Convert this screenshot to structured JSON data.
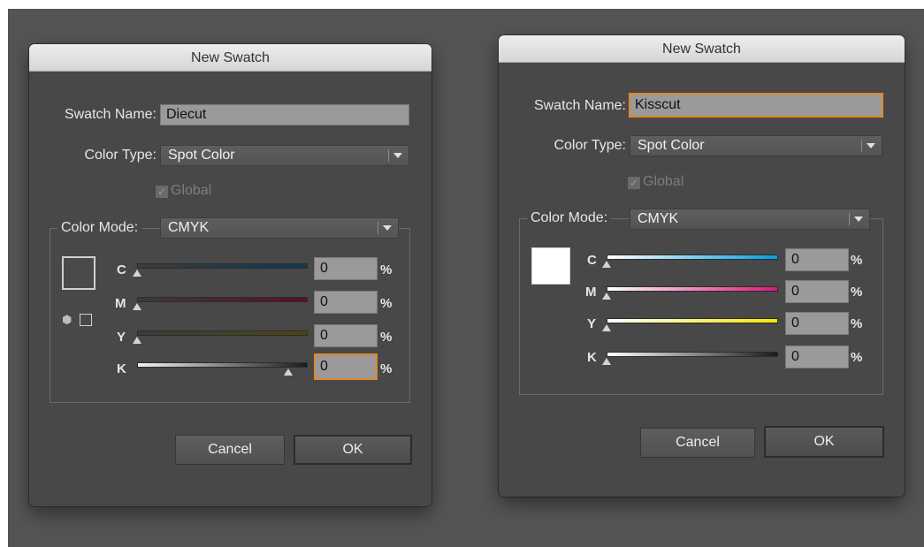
{
  "dialogs": [
    {
      "title": "New Swatch",
      "swatch_name_label": "Swatch Name:",
      "swatch_name_value": "Diecut",
      "color_type_label": "Color Type:",
      "color_type_value": "Spot Color",
      "global_label": "Global",
      "global_checked": true,
      "color_mode_label": "Color Mode:",
      "color_mode_value": "CMYK",
      "channels": [
        {
          "label": "C",
          "value": "0",
          "unit": "%",
          "position": 0
        },
        {
          "label": "M",
          "value": "0",
          "unit": "%",
          "position": 0
        },
        {
          "label": "Y",
          "value": "0",
          "unit": "%",
          "position": 0
        },
        {
          "label": "K",
          "value": "0",
          "unit": "%",
          "position": 1
        }
      ],
      "cancel_label": "Cancel",
      "ok_label": "OK"
    },
    {
      "title": "New Swatch",
      "swatch_name_label": "Swatch Name:",
      "swatch_name_value": "Kisscut",
      "color_type_label": "Color Type:",
      "color_type_value": "Spot Color",
      "global_label": "Global",
      "global_checked": true,
      "color_mode_label": "Color Mode:",
      "color_mode_value": "CMYK",
      "channels": [
        {
          "label": "C",
          "value": "0",
          "unit": "%",
          "position": 0
        },
        {
          "label": "M",
          "value": "0",
          "unit": "%",
          "position": 0
        },
        {
          "label": "Y",
          "value": "0",
          "unit": "%",
          "position": 0
        },
        {
          "label": "K",
          "value": "0",
          "unit": "%",
          "position": 0
        }
      ],
      "cancel_label": "Cancel",
      "ok_label": "OK"
    }
  ],
  "colors": {
    "focus_ring": "#e0882a",
    "dialog_bg": "#484848",
    "left_preview": "#4a4a4a",
    "right_preview": "#ffffff"
  }
}
